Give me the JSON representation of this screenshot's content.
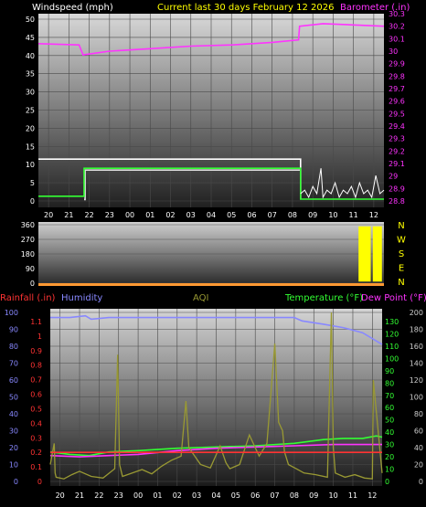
{
  "header": {
    "title": "Current last 30 days February 12 2026",
    "windspeed_label": "Windspeed (mph)",
    "barometer_label": "Barometer (.in)",
    "colors": {
      "title": "#ffff00",
      "windspeed": "#ffffff",
      "barometer": "#ff33ff"
    }
  },
  "x_tick_labels": [
    "20",
    "21",
    "22",
    "23",
    "00",
    "01",
    "02",
    "03",
    "04",
    "05",
    "06",
    "07",
    "08",
    "09",
    "10",
    "11",
    "12"
  ],
  "chart_data": [
    {
      "type": "line",
      "name": "wind-barometer",
      "ylabel_left": "Windspeed (mph)",
      "ylabel_right": "Barometer (.in)",
      "ylim_left": [
        0,
        50
      ],
      "ylim_right": [
        28.8,
        30.3
      ],
      "left_ticks": [
        "0",
        "5",
        "10",
        "15",
        "20",
        "25",
        "30",
        "35",
        "40",
        "45",
        "50"
      ],
      "right_ticks": [
        "28.8",
        "28.9",
        "29",
        "29.1",
        "29.2",
        "29.3",
        "29.4",
        "29.5",
        "29.6",
        "29.7",
        "29.8",
        "29.9",
        "30",
        "30.1",
        "30.2",
        "30.3"
      ],
      "x_range": [
        19.5,
        36.5
      ],
      "series": [
        {
          "key": "barometer",
          "axis": "right",
          "color": "#ff33ff",
          "x": [
            19.5,
            21.5,
            21.7,
            23,
            25,
            27,
            29,
            31,
            32.3,
            32.35,
            33.5,
            35,
            36.5
          ],
          "y": [
            30.06,
            30.05,
            29.97,
            30.0,
            30.02,
            30.04,
            30.05,
            30.07,
            30.09,
            30.2,
            30.22,
            30.21,
            30.2
          ]
        },
        {
          "key": "wind_high",
          "axis": "left",
          "color": "#ffffff",
          "x": [
            19.5,
            32.35,
            32.4
          ],
          "y": [
            11.5,
            11.5,
            0.4
          ]
        },
        {
          "key": "wind_avg",
          "axis": "left",
          "color": "#dddddd",
          "x": [
            21.75,
            21.8,
            32.35,
            32.4
          ],
          "y": [
            0.4,
            8.5,
            8.5,
            0.4
          ]
        },
        {
          "key": "gust",
          "axis": "left",
          "color": "#33ff33",
          "x": [
            19.5,
            21.6,
            21.75,
            32.35,
            32.4,
            36.5
          ],
          "y": [
            1.3,
            1.3,
            9.0,
            9.0,
            0.5,
            0.5
          ]
        },
        {
          "key": "wind_live",
          "axis": "left",
          "color": "#ffffff",
          "x": [
            32.4,
            32.6,
            32.8,
            33.0,
            33.2,
            33.4,
            33.5,
            33.7,
            33.9,
            34.1,
            34.3,
            34.5,
            34.7,
            34.9,
            35.1,
            35.3,
            35.5,
            35.7,
            35.9,
            36.1,
            36.3,
            36.5
          ],
          "y": [
            2,
            3,
            1,
            4,
            2,
            9,
            1,
            3,
            2,
            5,
            1,
            3,
            2,
            4,
            1,
            5,
            2,
            3,
            1,
            7,
            2,
            3
          ]
        }
      ]
    },
    {
      "type": "bar",
      "name": "wind-direction",
      "ylim": [
        0,
        360
      ],
      "left_ticks": [
        "0",
        "90",
        "180",
        "270",
        "360"
      ],
      "compass_labels": [
        "N",
        "W",
        "S",
        "E",
        "N"
      ],
      "x_range": [
        19.5,
        36.5
      ],
      "direction_bands": [
        {
          "x0": 35.25,
          "x1": 35.85,
          "deg_low": 10,
          "deg_high": 350
        },
        {
          "x0": 35.95,
          "x1": 36.4,
          "deg_low": 10,
          "deg_high": 350
        }
      ],
      "baseline_color": "#ff9933",
      "band_color": "#ffff00"
    },
    {
      "type": "line",
      "name": "humidity-rain-temp",
      "labels": {
        "rainfall": "Rainfall (.in)",
        "humidity": "Humidity",
        "aqi": "AQI",
        "temperature": "Temperature (°F)",
        "dewpoint": "Dew Point (°F)"
      },
      "colors": {
        "rainfall": "#ff3333",
        "humidity": "#8888ff",
        "aqi": "#999933",
        "temperature": "#33ff33",
        "dewpoint": "#ff33ff"
      },
      "humidity_ticks": [
        "0",
        "10",
        "20",
        "30",
        "40",
        "50",
        "60",
        "70",
        "80",
        "90",
        "100"
      ],
      "rain_ticks": [
        "0",
        "0.1",
        "0.2",
        "0.3",
        "0.4",
        "0.5",
        "0.6",
        "0.7",
        "0.8",
        "0.9",
        "1",
        "1.1"
      ],
      "temp_ticks": [
        "0",
        "10",
        "20",
        "30",
        "40",
        "50",
        "60",
        "70",
        "80",
        "90",
        "100",
        "110",
        "120",
        "130"
      ],
      "aqi_ticks": [
        "0",
        "20",
        "40",
        "60",
        "80",
        "100",
        "120",
        "140",
        "160",
        "180",
        "200"
      ],
      "ylim_humidity": [
        0,
        100
      ],
      "ylim_temp": [
        0,
        130
      ],
      "ylim_aqi": [
        0,
        200
      ],
      "x_range": [
        19.5,
        36.5
      ],
      "series": [
        {
          "key": "humidity",
          "axis": "humidity",
          "color": "#8888ff",
          "x": [
            19.5,
            20.5,
            21.3,
            21.6,
            22.5,
            24,
            26,
            28,
            30,
            32,
            32.4,
            33.5,
            34.5,
            35.5,
            36.5
          ],
          "y": [
            97,
            97,
            98,
            96,
            97,
            97,
            97,
            97,
            97,
            97,
            95,
            93,
            91,
            88,
            81
          ]
        },
        {
          "key": "temperature",
          "axis": "temp",
          "color": "#33ff33",
          "x": [
            19.5,
            20.5,
            21.5,
            22.5,
            24,
            26,
            28,
            30,
            32,
            33.5,
            34.5,
            35.5,
            36.2,
            36.5
          ],
          "y": [
            24,
            22,
            21,
            24,
            25,
            27,
            28,
            29,
            31,
            34,
            35,
            35,
            37,
            36
          ]
        },
        {
          "key": "dewpoint",
          "axis": "temp",
          "color": "#ff33ff",
          "x": [
            19.5,
            21,
            22.5,
            24,
            26,
            28,
            30,
            32,
            34,
            36.5
          ],
          "y": [
            21,
            20,
            21,
            22,
            25,
            27,
            28,
            29,
            30,
            30
          ]
        },
        {
          "key": "aqi",
          "axis": "aqi",
          "color": "#999933",
          "x": [
            19.5,
            19.7,
            19.75,
            19.8,
            20.2,
            20.6,
            21,
            21.6,
            22.2,
            22.8,
            22.95,
            23.05,
            23.2,
            23.7,
            24.2,
            24.7,
            25.2,
            25.7,
            26.2,
            26.45,
            26.6,
            27.2,
            27.7,
            28.2,
            28.5,
            28.7,
            29.2,
            29.7,
            30.2,
            30.6,
            31.0,
            31.2,
            31.4,
            31.5,
            31.7,
            32.1,
            32.5,
            33.1,
            33.7,
            33.9,
            34.0,
            34.1,
            34.6,
            35.1,
            35.6,
            36.0,
            36.05,
            36.5
          ],
          "y": [
            20,
            45,
            10,
            5,
            3,
            8,
            12,
            6,
            4,
            15,
            150,
            20,
            6,
            10,
            14,
            9,
            18,
            25,
            30,
            95,
            40,
            20,
            16,
            42,
            22,
            15,
            20,
            55,
            30,
            45,
            163,
            70,
            60,
            35,
            20,
            15,
            10,
            8,
            5,
            200,
            40,
            10,
            5,
            8,
            4,
            3,
            120,
            10
          ]
        },
        {
          "key": "rainfall",
          "axis": "humidity",
          "color": "#ff3333",
          "x": [
            19.5,
            36.5
          ],
          "y": [
            0.2,
            0.2
          ]
        }
      ]
    }
  ]
}
